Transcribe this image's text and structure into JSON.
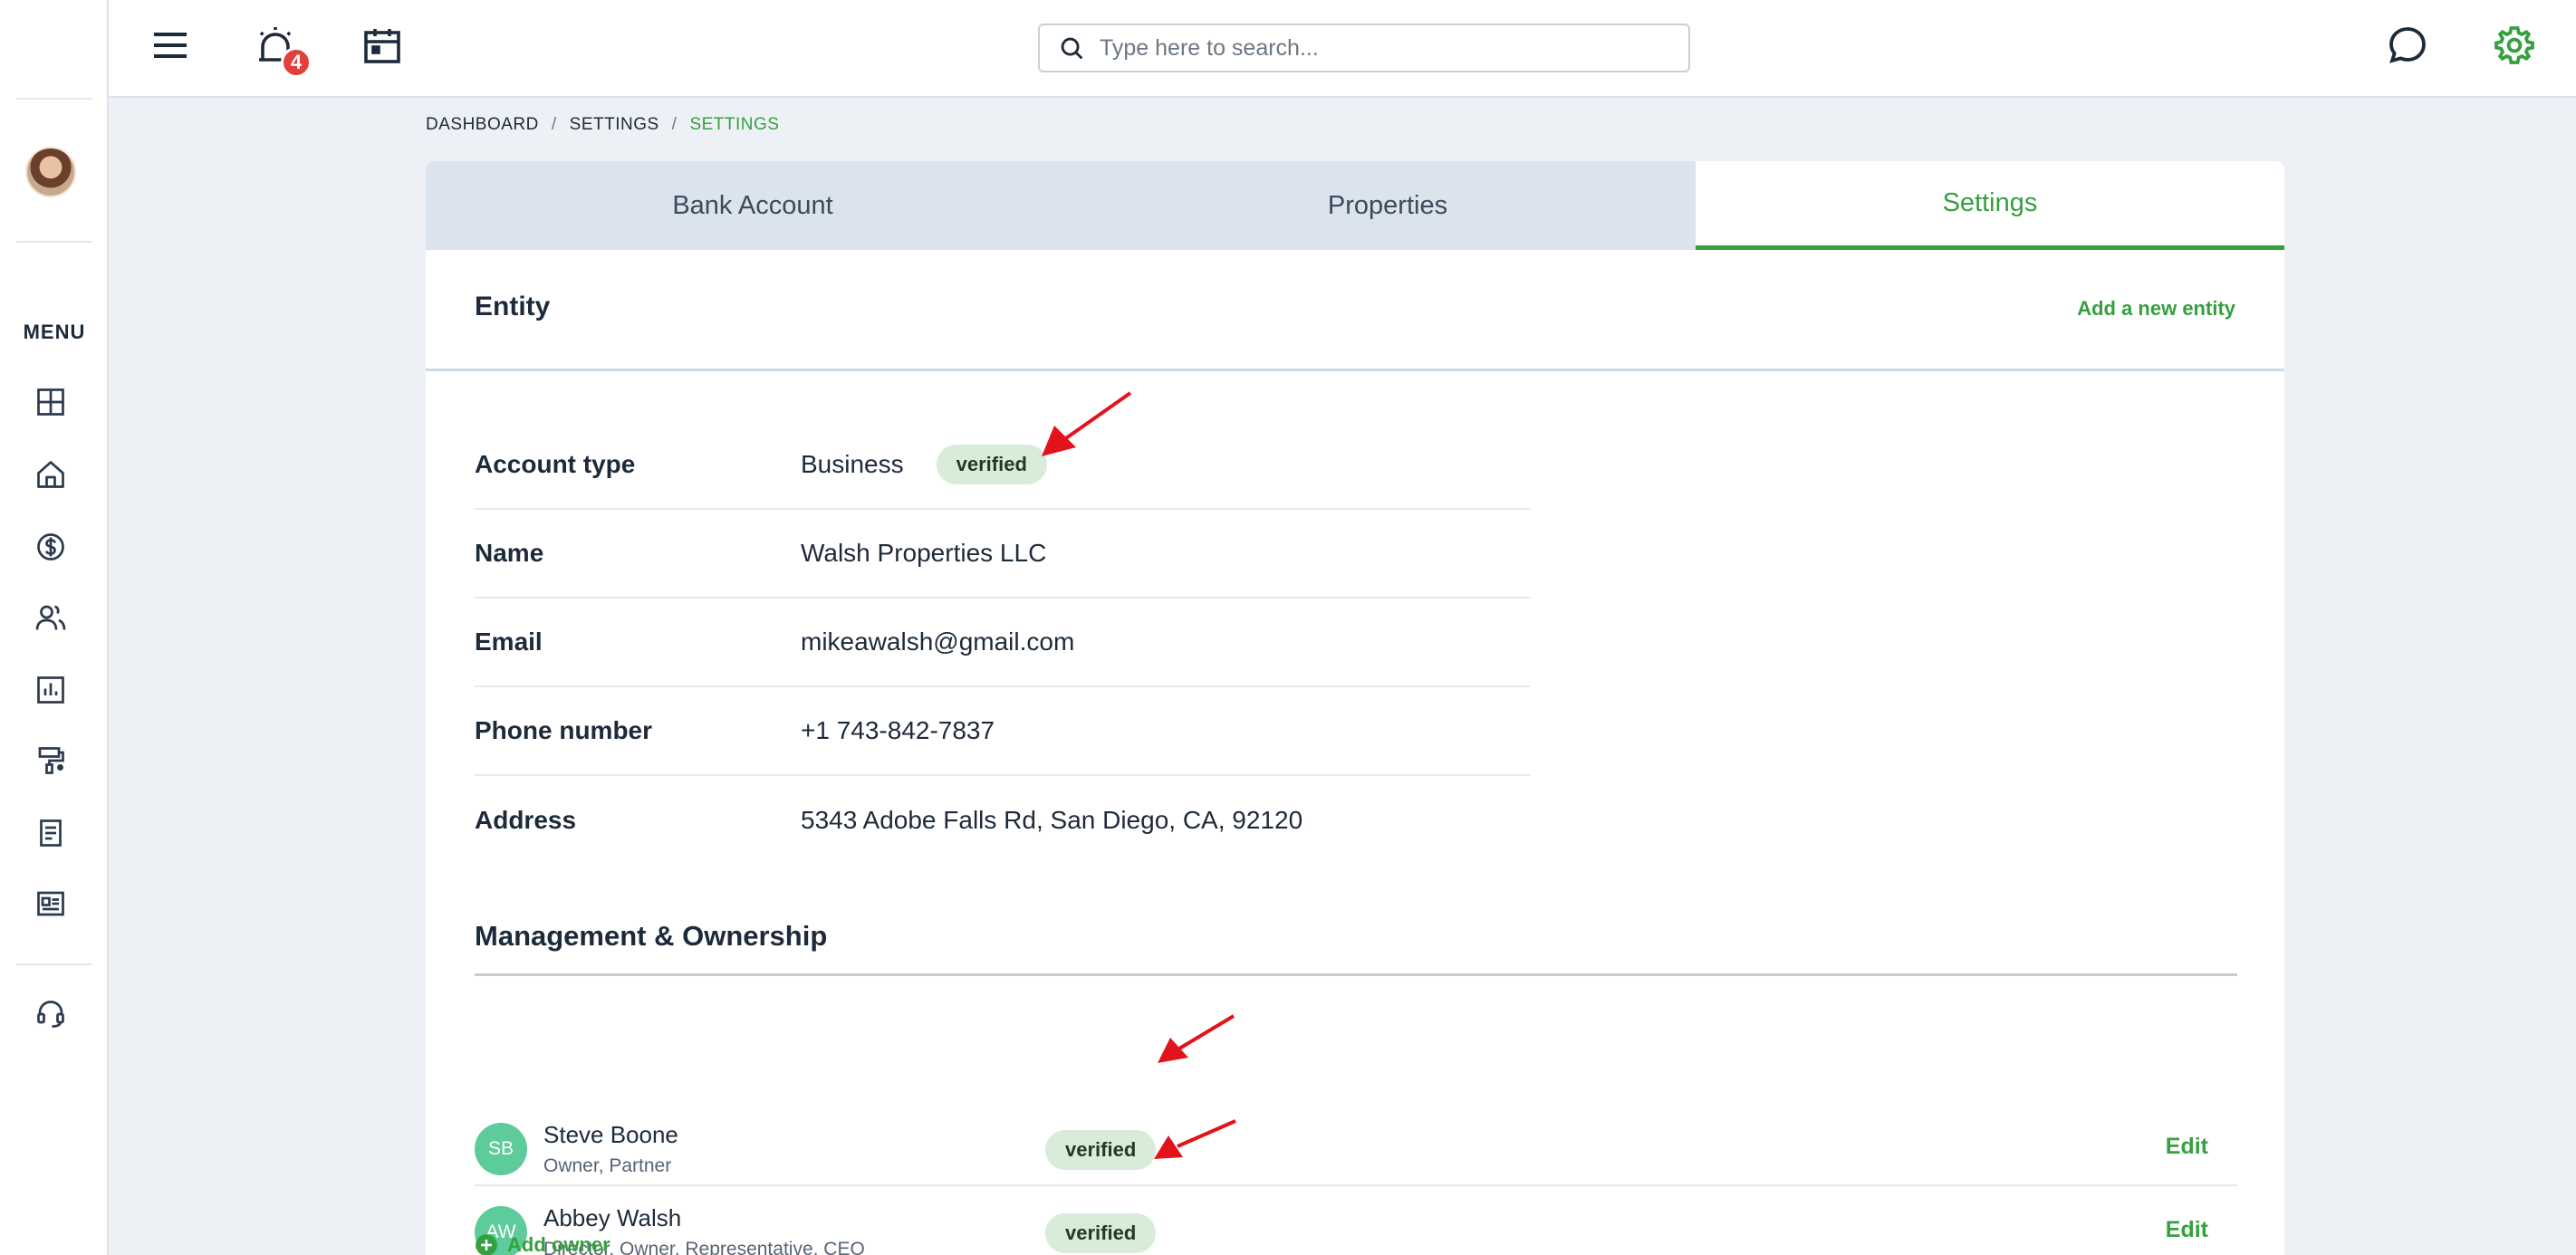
{
  "topbar": {
    "notification_count": "4",
    "search_placeholder": "Type here to search..."
  },
  "sidebar": {
    "menu_label": "MENU",
    "items": [
      {
        "icon": "dashboard-icon"
      },
      {
        "icon": "home-icon"
      },
      {
        "icon": "dollar-icon"
      },
      {
        "icon": "users-icon"
      },
      {
        "icon": "reports-icon"
      },
      {
        "icon": "maintenance-icon"
      },
      {
        "icon": "document-icon"
      },
      {
        "icon": "listing-icon"
      },
      {
        "icon": "support-icon"
      }
    ]
  },
  "breadcrumb": {
    "items": [
      "DASHBOARD",
      "SETTINGS",
      "SETTINGS"
    ],
    "separator": "/"
  },
  "tabs": [
    "Bank Account",
    "Properties",
    "Settings"
  ],
  "entity": {
    "title": "Entity",
    "add_link": "Add a new entity",
    "fields": [
      {
        "label": "Account type",
        "value": "Business",
        "badge": "verified"
      },
      {
        "label": "Name",
        "value": "Walsh Properties LLC"
      },
      {
        "label": "Email",
        "value": "mikeawalsh@gmail.com"
      },
      {
        "label": "Phone number",
        "value": "+1 743-842-7837"
      },
      {
        "label": "Address",
        "value": "5343 Adobe Falls Rd, San Diego, CA, 92120"
      }
    ]
  },
  "management": {
    "title": "Management & Ownership",
    "owners": [
      {
        "initials": "SB",
        "name": "Steve Boone",
        "role": "Owner, Partner",
        "badge": "verified",
        "action": "Edit"
      },
      {
        "initials": "AW",
        "name": "Abbey Walsh",
        "role": "Director, Owner, Representative, CEO",
        "badge": "verified",
        "action": "Edit"
      }
    ],
    "add_owner": "Add owner"
  },
  "colors": {
    "accent": "#35a03e",
    "badge_bg": "#d8ecd9",
    "annotation_arrow": "#e3131b",
    "notification": "#e0413b"
  }
}
